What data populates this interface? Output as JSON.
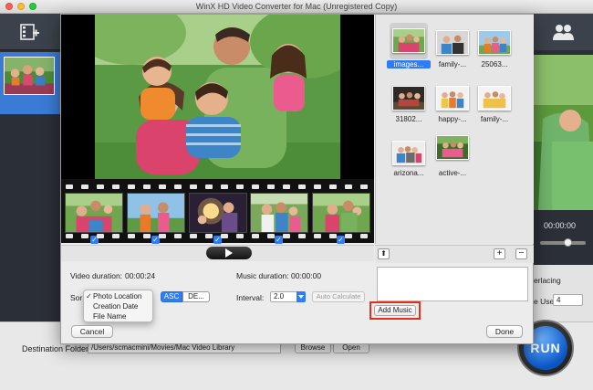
{
  "window": {
    "title": "WinX HD Video Converter for Mac (Unregistered Copy)"
  },
  "preview_strip": {
    "time": "00:00:00"
  },
  "background_panel": {
    "deinterlacing_label": "erlacing",
    "cpu_use_label": "e Use:",
    "cpu_use_value": "4"
  },
  "bottom_bar": {
    "destination_label": "Destination Folder:",
    "destination_path": "/Users/scmacmini/Movies/Mac Video Library",
    "browse_label": "Browse",
    "open_label": "Open",
    "run_label": "RUN"
  },
  "dialog": {
    "video_duration_label": "Video duration:",
    "video_duration_value": "00:00:24",
    "music_duration_label": "Music duration:",
    "music_duration_value": "00:00:00",
    "sort_label": "Sor",
    "sort_menu": {
      "checked": "✓",
      "items": [
        "Photo Location",
        "Creation Date",
        "File Name"
      ]
    },
    "asc_label": "ASC",
    "desc_label": "DE...",
    "interval_label": "Interval:",
    "interval_value": "2.0",
    "auto_calculate_label": "Auto Calculate",
    "add_music_label": "Add Music",
    "cancel_label": "Cancel",
    "done_label": "Done",
    "browser": {
      "up_label": "⬆",
      "plus_label": "+",
      "minus_label": "−",
      "images": [
        {
          "label": "images...",
          "selected": true
        },
        {
          "label": "family-...",
          "selected": false
        },
        {
          "label": "25063...",
          "selected": false
        },
        {
          "label": "31802...",
          "selected": false
        },
        {
          "label": "happy-...",
          "selected": false
        },
        {
          "label": "family-...",
          "selected": false
        },
        {
          "label": "arizona...",
          "selected": false
        },
        {
          "label": "active-...",
          "selected": false
        }
      ]
    },
    "filmstrip": {
      "frames": 5,
      "check_mark": "✓"
    }
  },
  "colors": {
    "accent": "#2f7cf6",
    "highlight_box": "#e0301e",
    "dark_chrome": "#2b2f36"
  }
}
